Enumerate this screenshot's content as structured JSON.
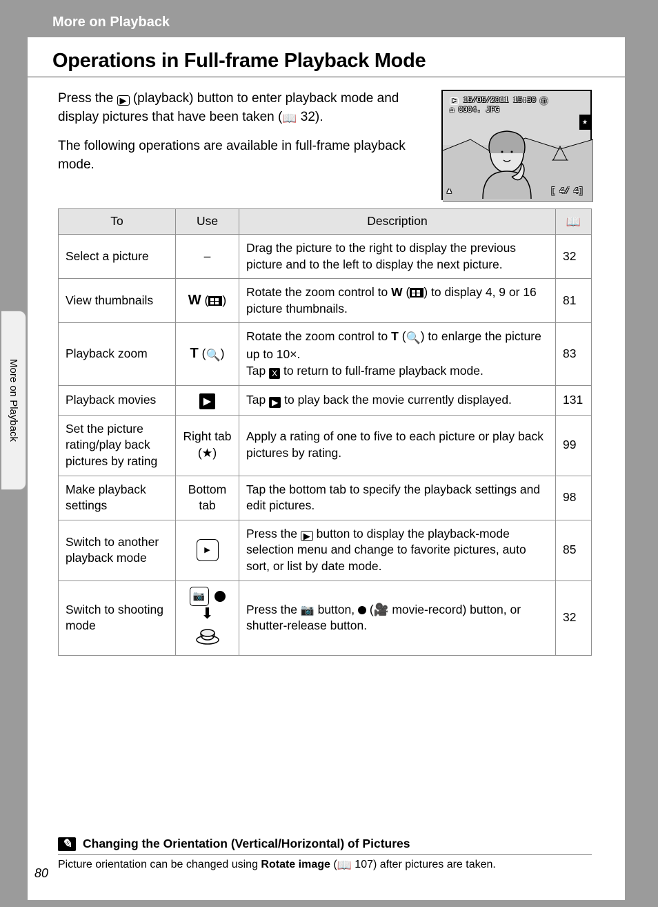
{
  "breadcrumb": "More on Playback",
  "title": "Operations in Full-frame Playback Mode",
  "intro": {
    "p1_a": "Press the ",
    "p1_b": " (playback) button to enter playback mode and display pictures that have been taken (",
    "p1_ref": " 32).",
    "p2": "The following operations are available in full-frame playback mode."
  },
  "lcd": {
    "datetime": "15/05/2011 15:30",
    "file": "0004. JPG",
    "counter_left": "4/",
    "counter_right": "4]",
    "open_br": "["
  },
  "table": {
    "headers": {
      "to": "To",
      "use": "Use",
      "desc": "Description",
      "ref_icon": "book"
    },
    "rows": [
      {
        "to": "Select a picture",
        "use_plain": "–",
        "desc": "Drag the picture to the right to display the previous picture and to the left to display the next picture.",
        "ref": "32"
      },
      {
        "to": "View thumbnails",
        "use_html": "W_THUMB",
        "desc_html": "THUMB_DESC",
        "desc_a": "Rotate the zoom control to ",
        "desc_b": " to display 4, 9 or 16 picture thumbnails.",
        "ref": "81"
      },
      {
        "to": "Playback zoom",
        "use_html": "T_MAG",
        "desc_a": "Rotate the zoom control to ",
        "desc_b": " to enlarge the picture up to 10×.",
        "desc_c": "Tap ",
        "desc_d": " to return to full-frame playback mode.",
        "ref": "83"
      },
      {
        "to": "Playback movies",
        "use_html": "PLAY_FILLED",
        "desc_a": "Tap ",
        "desc_b": " to play back the movie currently displayed.",
        "ref": "131"
      },
      {
        "to": "Set the picture rating/play back pictures by rating",
        "use_a": "Right tab",
        "use_b": "(★)",
        "desc": "Apply a rating of one to five to each picture or play back pictures by rating.",
        "ref": "99"
      },
      {
        "to": "Make playback settings",
        "use_a": "Bottom tab",
        "desc": "Tap the bottom tab to specify the playback settings and edit pictures.",
        "ref": "98"
      },
      {
        "to": "Switch to another playback mode",
        "use_html": "PLAYMODE",
        "desc_a": "Press the ",
        "desc_b": " button to display the playback-mode selection menu and change to favorite pictures, auto sort, or list by date mode.",
        "ref": "85"
      },
      {
        "to": "Switch to shooting mode",
        "use_html": "SHOOT",
        "desc_a": "Press the ",
        "desc_b": " button, ",
        "desc_c": " (",
        "desc_d": " movie-record) button, or shutter-release button.",
        "ref": "32"
      }
    ]
  },
  "note": {
    "title": "Changing the Orientation (Vertical/Horizontal) of Pictures",
    "body_a": "Picture orientation can be changed using ",
    "body_bold": "Rotate image",
    "body_b": " (",
    "body_ref": " 107) after pictures are taken."
  },
  "sidebar_label": "More on Playback",
  "page_number": "80"
}
